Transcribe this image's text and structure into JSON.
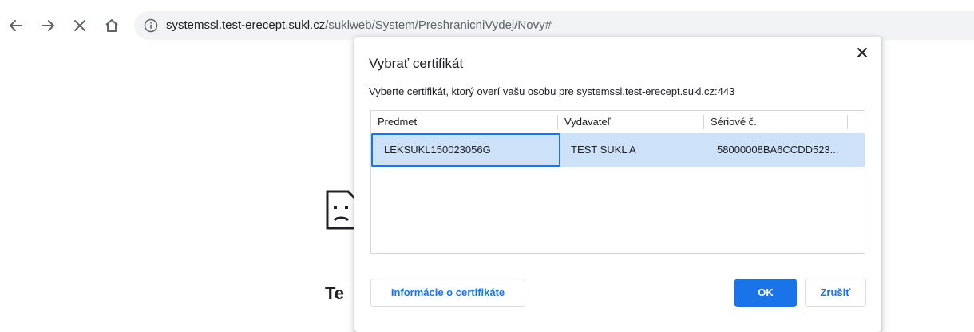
{
  "browser": {
    "url_host": "systemssl.test-erecept.sukl.cz",
    "url_path": "/suklweb/System/PreshranicniVydej/Novy#",
    "nav_icons": [
      "back-arrow-icon",
      "forward-arrow-icon",
      "stop-icon",
      "home-icon",
      "info-icon"
    ]
  },
  "page": {
    "error_title_fragment": "Te"
  },
  "dialog": {
    "title": "Vybrať certifikát",
    "description": "Vyberte certifikát, ktorý overí vašu osobu pre systemssl.test-erecept.sukl.cz:443",
    "columns": [
      "Predmet",
      "Vydavateľ",
      "Sériové č."
    ],
    "rows": [
      {
        "subject": "LEKSUKL150023056G",
        "issuer": "TEST SUKL A",
        "serial": "58000008BA6CCDD523..."
      }
    ],
    "info_button_label": "Informácie o certifikáte",
    "ok_label": "OK",
    "cancel_label": "Zrušiť"
  },
  "colors": {
    "accent": "#1a73e8",
    "selection": "#cde1f9",
    "omnibox_bg": "#f1f3f4"
  }
}
